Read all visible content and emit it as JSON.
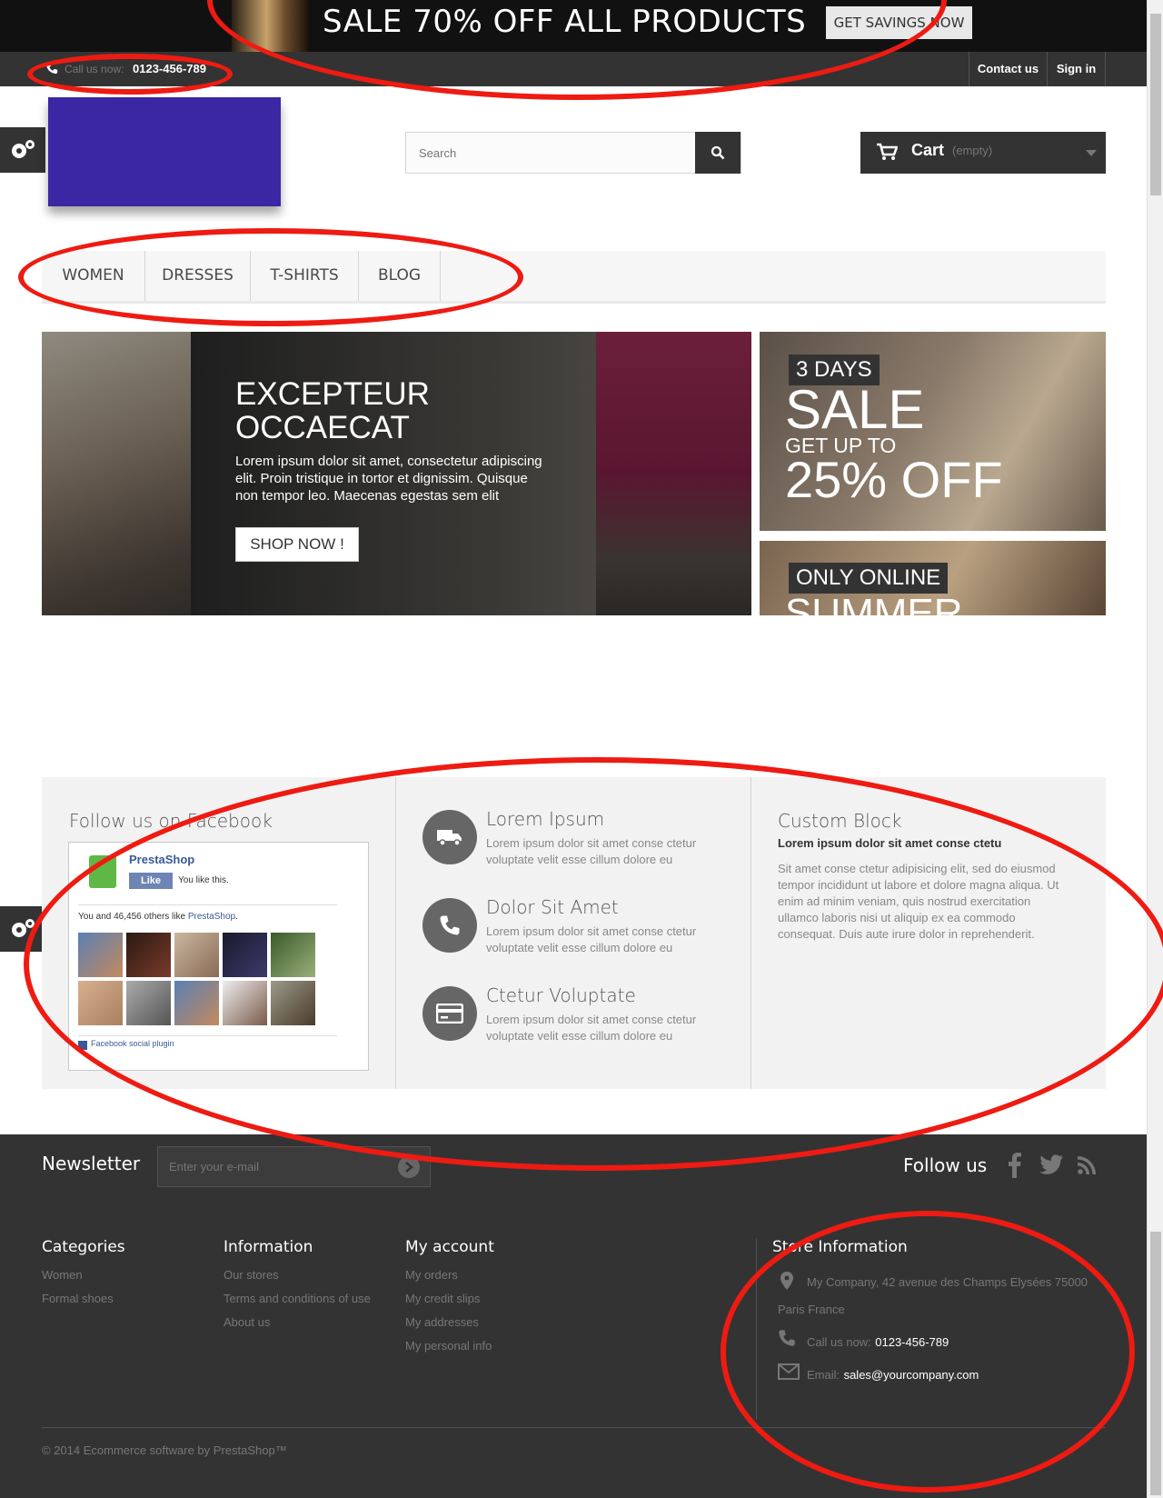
{
  "banner": {
    "sale_text": "SALE 70% OFF ALL PRODUCTS",
    "savings_button": "GET SAVINGS NOW"
  },
  "topbar": {
    "call_label": "Call us now:",
    "phone": "0123-456-789",
    "links": [
      "Contact us",
      "Sign in"
    ]
  },
  "header": {
    "search_placeholder": "Search",
    "cart_label": "Cart",
    "cart_status": "(empty)"
  },
  "menu": {
    "items": [
      "Women",
      "Dresses",
      "T-shirts",
      "Blog"
    ]
  },
  "slider": {
    "title": "EXCEPTEUR OCCAECAT",
    "description": "Lorem ipsum dolor sit amet, consectetur adipiscing elit. Proin tristique in tortor et dignissim. Quisque non tempor leo. Maecenas egestas sem elit",
    "button": "SHOP NOW !"
  },
  "promo1": {
    "tag": "3 DAYS",
    "line1": "SALE",
    "line2": "GET UP TO",
    "line3": "25% OFF"
  },
  "promo2": {
    "tag": "ONLY ONLINE",
    "line1": "SUMMER"
  },
  "facebook": {
    "heading": "Follow us on Facebook",
    "page_name": "PrestaShop",
    "like_button": "Like",
    "you_like": "You like this.",
    "others_prefix": "You and 46,456 others like ",
    "others_page": "PrestaShop",
    "others_suffix": ".",
    "plugin_label": "Facebook social plugin"
  },
  "features": [
    {
      "title": "Lorem Ipsum",
      "text": "Lorem ipsum dolor sit amet conse ctetur voluptate velit esse cillum dolore eu",
      "icon": "truck-icon"
    },
    {
      "title": "Dolor Sit Amet",
      "text": "Lorem ipsum dolor sit amet conse ctetur voluptate velit esse cillum dolore eu",
      "icon": "phone-icon"
    },
    {
      "title": "Ctetur Voluptate",
      "text": "Lorem ipsum dolor sit amet conse ctetur voluptate velit esse cillum dolore eu",
      "icon": "credit-card-icon"
    }
  ],
  "custom_block": {
    "title": "Custom Block",
    "subtitle": "Lorem ipsum dolor sit amet conse ctetu",
    "text": "Sit amet conse ctetur adipisicing elit, sed do eiusmod tempor incididunt ut labore et dolore magna aliqua. Ut enim ad minim veniam, quis nostrud exercitation ullamco laboris nisi ut aliquip ex ea commodo consequat. Duis aute irure dolor in reprehenderit."
  },
  "newsletter": {
    "label": "Newsletter",
    "placeholder": "Enter your e-mail",
    "follow_label": "Follow us"
  },
  "footer": {
    "categories": {
      "title": "Categories",
      "links": [
        "Women",
        "Formal shoes"
      ]
    },
    "information": {
      "title": "Information",
      "links": [
        "Our stores",
        "Terms and conditions of use",
        "About us"
      ]
    },
    "account": {
      "title": "My account",
      "links": [
        "My orders",
        "My credit slips",
        "My addresses",
        "My personal info"
      ]
    },
    "store": {
      "title": "Store Information",
      "address_line1": "My Company, 42 avenue des Champs Elysées 75000",
      "address_line2": "Paris France",
      "call_label": "Call us now:",
      "phone": "0123-456-789",
      "email_label": "Email:",
      "email": "sales@yourcompany.com"
    },
    "copyright": "© 2014 Ecommerce software by PrestaShop™"
  },
  "colors": {
    "annotation": "#ee1b12",
    "logo": "#3b27a3",
    "dark": "#333333"
  }
}
